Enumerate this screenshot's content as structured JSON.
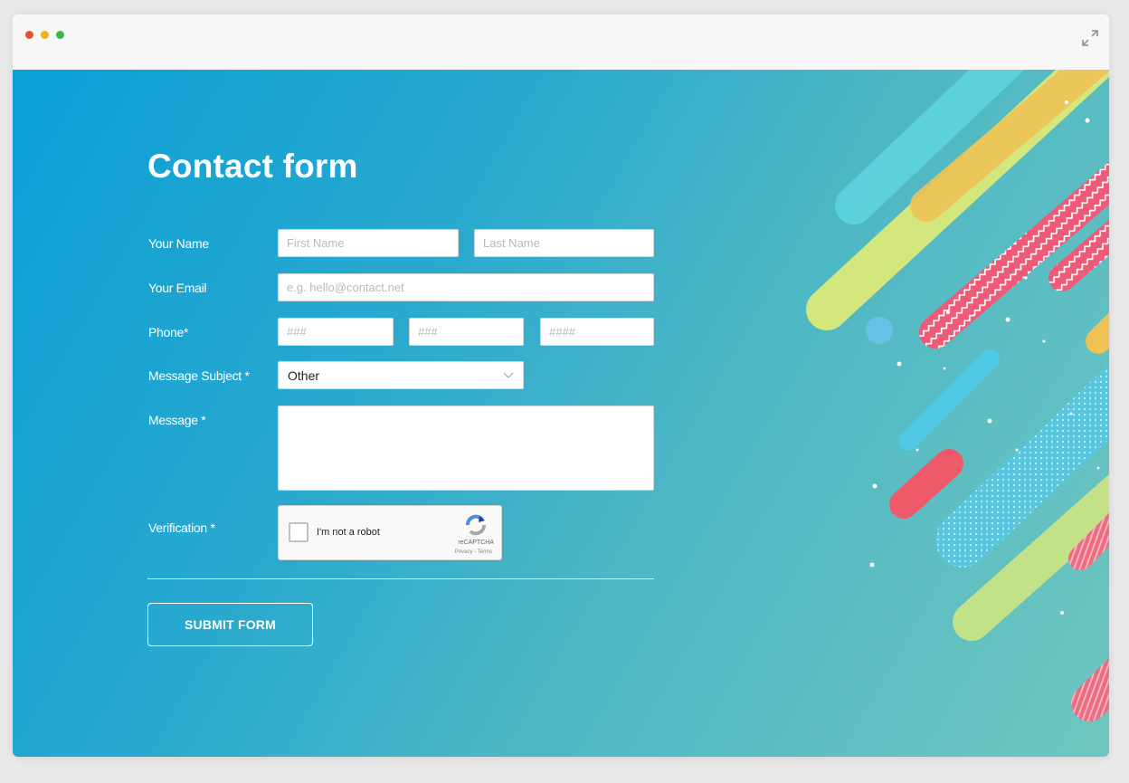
{
  "page": {
    "title": "Contact form"
  },
  "form": {
    "name": {
      "label": "Your Name",
      "first_placeholder": "First Name",
      "last_placeholder": "Last Name"
    },
    "email": {
      "label": "Your Email",
      "placeholder": "e.g. hello@contact.net"
    },
    "phone": {
      "label": "Phone*",
      "area_placeholder": "###",
      "prefix_placeholder": "###",
      "line_placeholder": "####"
    },
    "subject": {
      "label": "Message Subject *",
      "value": "Other"
    },
    "message": {
      "label": "Message *",
      "value": ""
    },
    "verification": {
      "label": "Verification *",
      "checkbox_label": "I'm not a robot",
      "brand": "reCAPTCHA",
      "links": "Privacy - Terms"
    },
    "submit_label": "SUBMIT FORM"
  },
  "icons": {
    "window_controls": [
      "close-dot",
      "minimize-dot",
      "maximize-dot"
    ],
    "expand": "expand-icon",
    "select_arrow": "chevron-down-icon",
    "captcha": "recaptcha-logo-icon"
  },
  "colors": {
    "gradient_start": "#0a9fd6",
    "gradient_end": "#6fc6bf",
    "button_border": "#ffffff",
    "stripe_pink": "#ee5a77",
    "stripe_yellow": "#f0c94b",
    "stripe_cyan": "#4fd6e2",
    "stripe_lime": "#d3e77c"
  }
}
